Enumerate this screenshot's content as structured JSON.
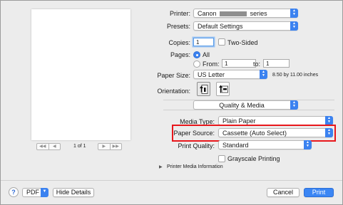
{
  "preview": {
    "page_indicator": "1 of 1",
    "first_prev_glyphs": [
      "◀◀",
      "◀"
    ],
    "next_last_glyphs": [
      "▶",
      "▶▶"
    ]
  },
  "printer": {
    "label": "Printer:",
    "value_prefix": "Canon",
    "value_suffix": "series"
  },
  "presets": {
    "label": "Presets:",
    "value": "Default Settings"
  },
  "copies": {
    "label": "Copies:",
    "value": "1",
    "two_sided_label": "Two-Sided"
  },
  "pages": {
    "label": "Pages:",
    "all_label": "All",
    "from_label": "From:",
    "from_value": "1",
    "to_label": "to:",
    "to_value": "1"
  },
  "paper_size": {
    "label": "Paper Size:",
    "value": "US Letter",
    "dimensions": "8.50 by 11.00 inches"
  },
  "orientation": {
    "label": "Orientation:"
  },
  "panel_menu": {
    "value": "Quality & Media"
  },
  "media_type": {
    "label": "Media Type:",
    "value": "Plain Paper"
  },
  "paper_source": {
    "label": "Paper Source:",
    "value": "Cassette (Auto Select)"
  },
  "print_quality": {
    "label": "Print Quality:",
    "value": "Standard"
  },
  "grayscale": {
    "label": "Grayscale Printing"
  },
  "media_info": {
    "label": "Printer Media Information"
  },
  "footer": {
    "help": "?",
    "pdf": "PDF",
    "hide_details": "Hide Details",
    "cancel": "Cancel",
    "print": "Print"
  },
  "colors": {
    "accent": "#3b82f0",
    "highlight": "#e8161b",
    "background": "#ececec"
  }
}
